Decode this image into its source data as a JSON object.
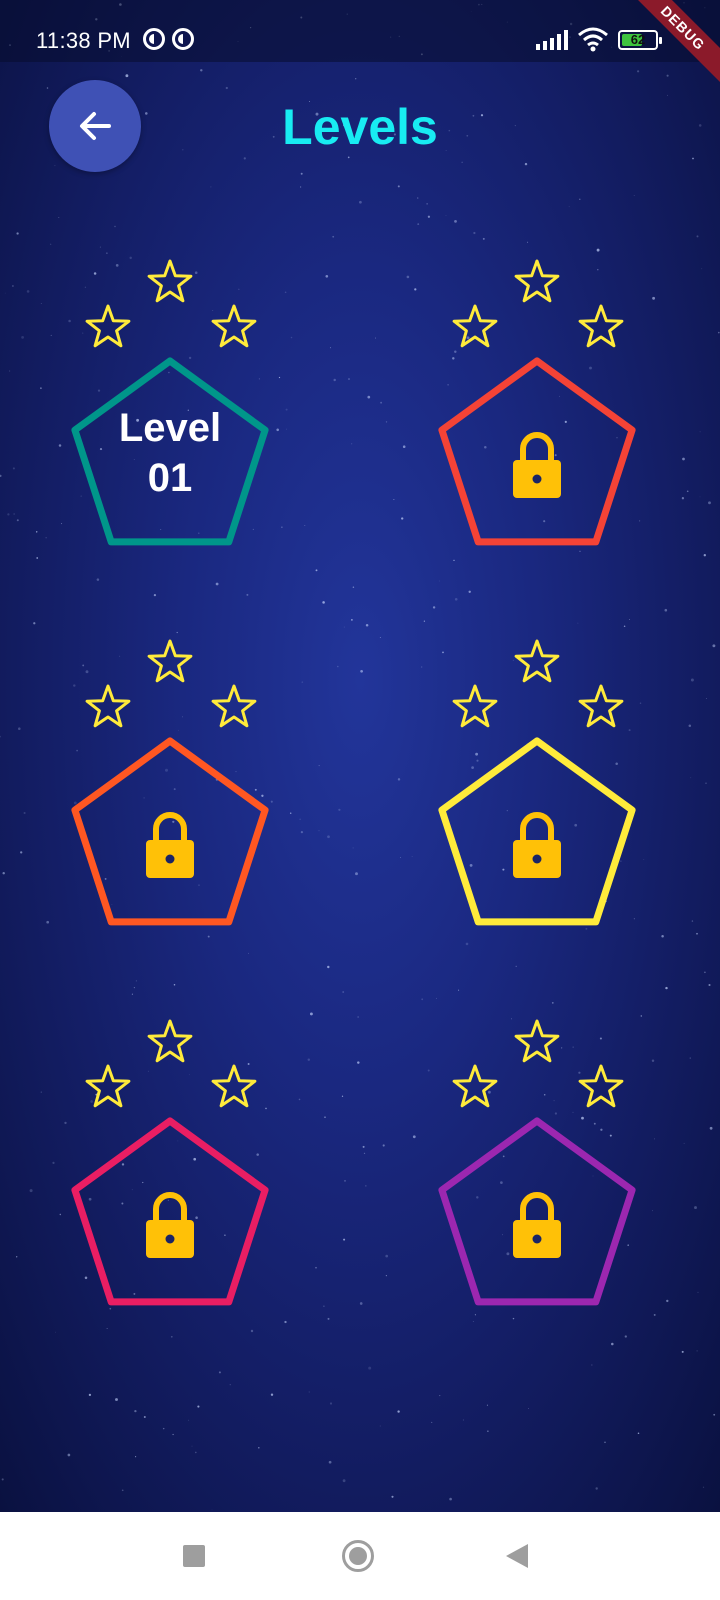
{
  "status_bar": {
    "time": "11:38 PM",
    "battery_percent": 62,
    "battery_label": "62"
  },
  "debug_banner": "DEBUG",
  "header": {
    "back_icon": "arrow-left-icon",
    "title": "Levels"
  },
  "colors": {
    "background": "#1a2880",
    "title": "#18ecf2",
    "back_button": "#3f51b5",
    "star_outline": "#ffeb3b",
    "lock": "#ffc107"
  },
  "levels": [
    {
      "label": "Level\n01",
      "locked": false,
      "stars_earned": 0,
      "stars_total": 3,
      "color": "#00968a"
    },
    {
      "label": "",
      "locked": true,
      "stars_earned": 0,
      "stars_total": 3,
      "color": "#f44336"
    },
    {
      "label": "",
      "locked": true,
      "stars_earned": 0,
      "stars_total": 3,
      "color": "#ff5722"
    },
    {
      "label": "",
      "locked": true,
      "stars_earned": 0,
      "stars_total": 3,
      "color": "#ffeb3b"
    },
    {
      "label": "",
      "locked": true,
      "stars_earned": 0,
      "stars_total": 3,
      "color": "#e91e63"
    },
    {
      "label": "",
      "locked": true,
      "stars_earned": 0,
      "stars_total": 3,
      "color": "#9c27b0"
    }
  ],
  "nav_bar": {
    "recent_icon": "square-icon",
    "home_icon": "circle-icon",
    "back_icon": "triangle-back-icon"
  }
}
